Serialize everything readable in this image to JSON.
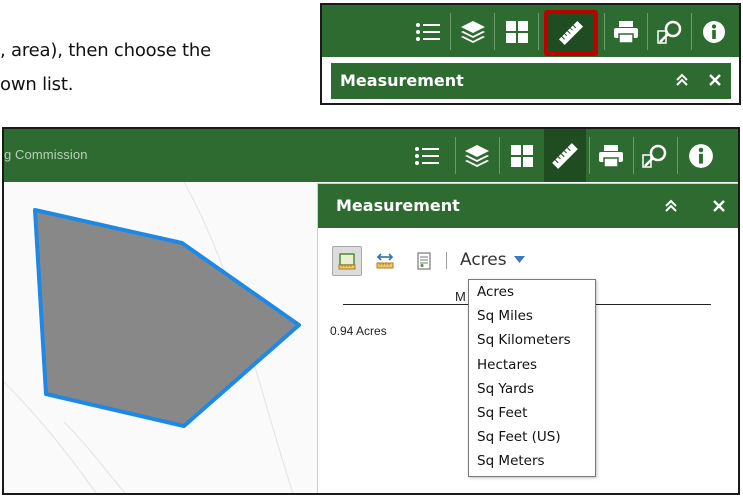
{
  "instructions": {
    "line1": ", area), then choose the",
    "line2": "own list."
  },
  "inset": {
    "panel_title": "Measurement",
    "toolbar_icons": [
      "list-icon",
      "layers-icon",
      "basemap-grid-icon",
      "ruler-icon",
      "print-icon",
      "search-zoom-icon",
      "info-icon"
    ],
    "highlighted_icon": "ruler-icon",
    "highlight_color": "#c00000"
  },
  "app": {
    "title": "g Commission",
    "theme_color": "#2e6b30",
    "active_color": "#1f4d21",
    "toolbar_icons": [
      "list-icon",
      "layers-icon",
      "basemap-grid-icon",
      "ruler-icon",
      "print-icon",
      "search-zoom-icon",
      "info-icon"
    ],
    "active_tool": "ruler-icon"
  },
  "measurement": {
    "title": "Measurement",
    "tools": [
      "area-tool",
      "distance-tool",
      "location-tool"
    ],
    "selected_tool": "area-tool",
    "unit_selected": "Acres",
    "result_heading": "M",
    "result_value": "0.94 Acres",
    "unit_options": [
      "Acres",
      "Sq Miles",
      "Sq Kilometers",
      "Hectares",
      "Sq Yards",
      "Sq Feet",
      "Sq Feet (US)",
      "Sq Meters"
    ]
  },
  "map": {
    "polygon_fill": "#888888",
    "polygon_stroke": "#1e88e5"
  }
}
